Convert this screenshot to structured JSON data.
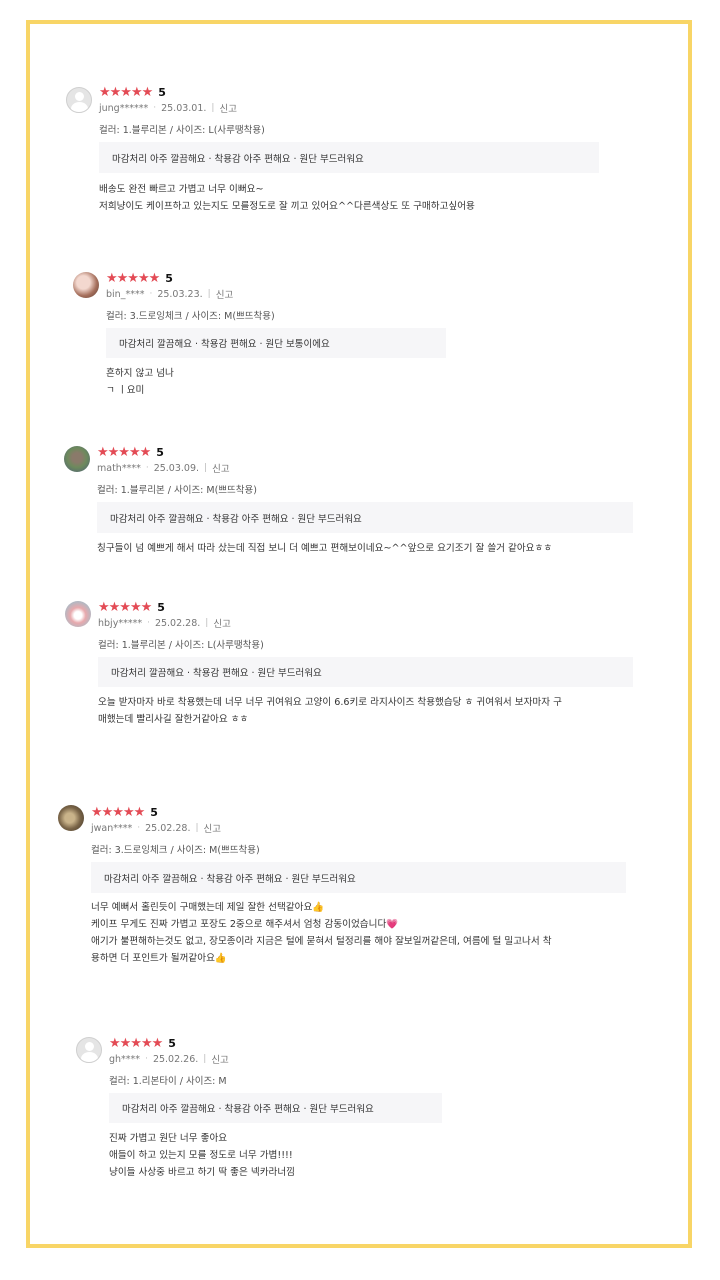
{
  "reviews": [
    {
      "stars": "★★★★★",
      "score": "5",
      "user": "jung******",
      "date": "25.03.01.",
      "report": "신고",
      "option": "컬러: 1.블루리본 / 사이즈: L(사루땡착용)",
      "tags": "마감처리 아주 깔끔해요 · 착용감 아주 편해요 · 원단 부드러워요",
      "body": [
        "배송도 완전 빠르고 가볍고 너무 이뻐요~",
        "저희냥이도 케이프하고 있는지도 모를정도로 잘 끼고 있어요^^다른색상도 또 구매하고싶어용"
      ]
    },
    {
      "stars": "★★★★★",
      "score": "5",
      "user": "bin_****",
      "date": "25.03.23.",
      "report": "신고",
      "option": "컬러: 3.드로잉체크 / 사이즈: M(쁘뜨착용)",
      "tags": "마감처리 깔끔해요 · 착용감 편해요 · 원단 보통이에요",
      "body": [
        "흔하지 않고 넘나",
        "ㄱ ㅣ요미"
      ]
    },
    {
      "stars": "★★★★★",
      "score": "5",
      "user": "math****",
      "date": "25.03.09.",
      "report": "신고",
      "option": "컬러: 1.블루리본 / 사이즈: M(쁘뜨착용)",
      "tags": "마감처리 아주 깔끔해요 · 착용감 아주 편해요 · 원단 부드러워요",
      "body": [
        "칭구들이 넘 예쁘게 해서 따라 샀는데 직접 보니 더 예쁘고 편해보이네요~^^앞으로 요기조기 잘 쓸거 같아요ㅎㅎ"
      ]
    },
    {
      "stars": "★★★★★",
      "score": "5",
      "user": "hbjy*****",
      "date": "25.02.28.",
      "report": "신고",
      "option": "컬러: 1.블루리본 / 사이즈: L(사루땡착용)",
      "tags": "마감처리 깔끔해요 · 착용감 편해요 · 원단 부드러워요",
      "body": [
        "오늘 받자마자 바로 착용했는데 너무 너무 귀여워요 고양이 6.6키로 라지사이즈 착용했습당 ㅎ 귀여워서 보자마자 구",
        "매했는데 빨리사길 잘한거같아요 ㅎㅎ"
      ]
    },
    {
      "stars": "★★★★★",
      "score": "5",
      "user": "jwan****",
      "date": "25.02.28.",
      "report": "신고",
      "option": "컬러: 3.드로잉체크 / 사이즈: M(쁘뜨착용)",
      "tags": "마감처리 아주 깔끔해요 · 착용감 아주 편해요 · 원단 부드러워요",
      "body": [
        "너무 예뻐서 홀린듯이 구매했는데 제일 잘한 선택같아요👍",
        "케이프 무게도 진짜 가볍고 포장도 2중으로 해주셔서 엄청 감동이었습니다💗",
        "애기가 불편해하는것도 없고, 장모종이라 지금은 털에 묻혀서 털정리를 해야 잘보일꺼같은데, 여름에 털 밀고나서 착",
        "용하면 더 포인트가 될꺼같아요👍"
      ]
    },
    {
      "stars": "★★★★★",
      "score": "5",
      "user": "gh****",
      "date": "25.02.26.",
      "report": "신고",
      "option": "컬러: 1.리본타이 / 사이즈: M",
      "tags": "마감처리 아주 깔끔해요 · 착용감 아주 편해요 · 원단 부드러워요",
      "body": [
        "진짜 가볍고 원단 너무 좋아요",
        "애들이 하고 있는지 모를 정도로 너무 가볍!!!!",
        "냥이들 사상중 바르고 하기 딱 좋은 넥카라너낌"
      ]
    }
  ]
}
